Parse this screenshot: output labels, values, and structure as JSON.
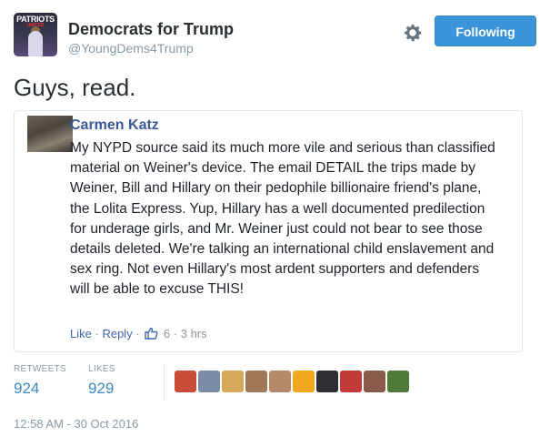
{
  "header": {
    "avatar_brand": "PATRIOTS",
    "avatar_brand_sub": "UNITED",
    "display_name": "Democrats for Trump",
    "screen_name": "@YoungDems4Trump",
    "follow_label": "Following"
  },
  "tweet": {
    "text": "Guys, read."
  },
  "quote": {
    "author": "Carmen Katz",
    "body": "My NYPD source said its much more vile and serious than classified material on Weiner's device. The email DETAIL the trips made by Weiner, Bill and Hillary on their pedophile billionaire friend's plane, the Lolita Express. Yup, Hillary has a well documented predilection for underage girls, and Mr. Weiner just could not bear to see those details deleted. We're talking an international child enslavement and sex ring. Not even Hillary's most ardent supporters and defenders will be able to excuse THIS!",
    "like_label": "Like",
    "separator": "·",
    "reply_label": "Reply",
    "reaction_count": "6",
    "time": "3 hrs"
  },
  "stats": {
    "retweets_label": "RETWEETS",
    "retweets_value": "924",
    "likes_label": "LIKES",
    "likes_value": "929",
    "liker_colors": [
      "#c94b3a",
      "#7a8ca8",
      "#d6a85a",
      "#a07858",
      "#b58a6a",
      "#f2a81e",
      "#2d2f35",
      "#c23b3b",
      "#8a5a4a",
      "#4f7a3a"
    ]
  },
  "timestamp": "12:58 AM - 30 Oct 2016",
  "colors": {
    "follow_button": "#3b94d9",
    "stat_values": "#3b88c3",
    "facebook_link": "#4267b2",
    "facebook_author": "#3b5998"
  },
  "icons": {
    "settings": "gear-icon",
    "reaction": "thumbs-up-icon"
  }
}
